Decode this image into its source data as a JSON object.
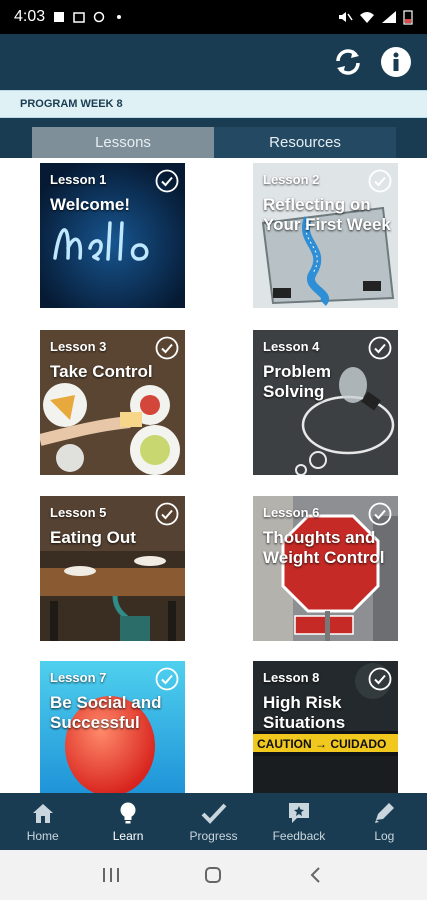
{
  "status_bar": {
    "time": "4:03"
  },
  "program": {
    "week_label": "PROGRAM WEEK 8"
  },
  "tabs": [
    {
      "label": "Lessons",
      "active": true
    },
    {
      "label": "Resources",
      "active": false
    }
  ],
  "lessons": [
    {
      "number": "Lesson 1",
      "title": "Welcome!",
      "completed": true,
      "image": "neon-hello"
    },
    {
      "number": "Lesson 2",
      "title": "Reflecting on Your First Week",
      "completed": true,
      "image": "scale-measuring-tape"
    },
    {
      "number": "Lesson 3",
      "title": "Take Control",
      "completed": true,
      "image": "food-table"
    },
    {
      "number": "Lesson 4",
      "title": "Problem Solving",
      "completed": true,
      "image": "lightbulb-chalkboard"
    },
    {
      "number": "Lesson 5",
      "title": "Eating Out",
      "completed": true,
      "image": "restaurant"
    },
    {
      "number": "Lesson 6",
      "title": "Thoughts and Weight Control",
      "completed": true,
      "image": "stop-sign"
    },
    {
      "number": "Lesson 7",
      "title": "Be Social and Successful",
      "completed": true,
      "image": "red-balloon"
    },
    {
      "number": "Lesson 8",
      "title": "High Risk Situations",
      "completed": true,
      "image": "caution-tape"
    }
  ],
  "bottom_nav": [
    {
      "label": "Home",
      "icon": "home-icon"
    },
    {
      "label": "Learn",
      "icon": "lightbulb-icon",
      "active": true
    },
    {
      "label": "Progress",
      "icon": "checkmark-icon"
    },
    {
      "label": "Feedback",
      "icon": "feedback-icon"
    },
    {
      "label": "Log",
      "icon": "pencil-icon"
    }
  ],
  "colors": {
    "primary": "#1a3c52",
    "banner": "#dff1f5",
    "tab_active": "#7e8f99"
  }
}
